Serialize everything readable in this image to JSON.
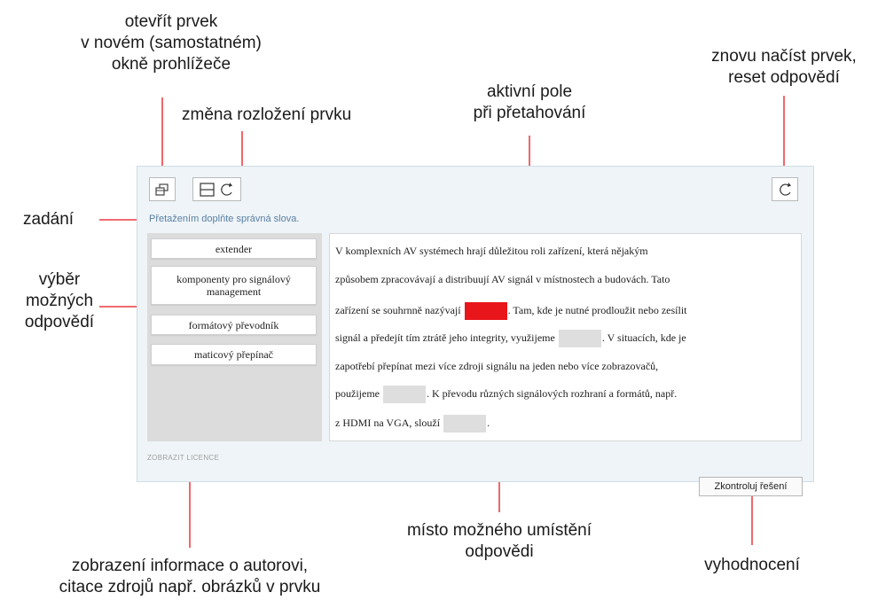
{
  "annotations": {
    "open_window": [
      "otevřít prvek",
      "v novém (samostatném)",
      "okně prohlížeče"
    ],
    "layout_change": "změna rozložení prvku",
    "active_field": [
      "aktivní pole",
      "při přetahování"
    ],
    "reload": [
      "znovu načíst prvek,",
      "reset odpovědí"
    ],
    "task": "zadání",
    "answer_choice": [
      "výběr",
      "možných",
      "odpovědí"
    ],
    "placement": [
      "místo možného umístění",
      "odpovědi"
    ],
    "author_info": [
      "zobrazení informace o autorovi,",
      "citace zdrojů např. obrázků v prvku"
    ],
    "evaluation": "vyhodnocení"
  },
  "widget": {
    "instruction": "Přetažením doplňte správná slova.",
    "answers": [
      "extender",
      "komponenty pro signálový management",
      "formátový převodník",
      "maticový přepínač"
    ],
    "text_lines": [
      "V komplexních AV systémech hrají důležitou roli zařízení, která nějakým",
      "způsobem zpracovávají a distribuují AV signál v místnostech a budovách. Tato",
      {
        "before": "zařízení se souhrnně nazývají",
        "after": ". Tam, kde je nutné prodloužit nebo zesílit"
      },
      {
        "before": "signál a předejít tím ztrátě jeho integrity, využijeme",
        "after": ". V situacích, kde je"
      },
      "zapotřebí přepínat mezi více zdroji signálu na jeden nebo více zobrazovačů,",
      {
        "before": "použijeme",
        "after": ". K převodu různých signálových rozhraní a formátů, např."
      },
      {
        "before": "z HDMI na VGA, slouží",
        "after": "."
      }
    ],
    "licence_link": "ZOBRAZIT LICENCE",
    "check_button": "Zkontroluj řešení"
  },
  "colors": {
    "active_slot": "#e8151a",
    "leader_line": "#e8151a",
    "empty_slot": "#dedede"
  },
  "icons": [
    "open-in-new-window-icon",
    "layout-toggle-icon",
    "reload-icon"
  ]
}
